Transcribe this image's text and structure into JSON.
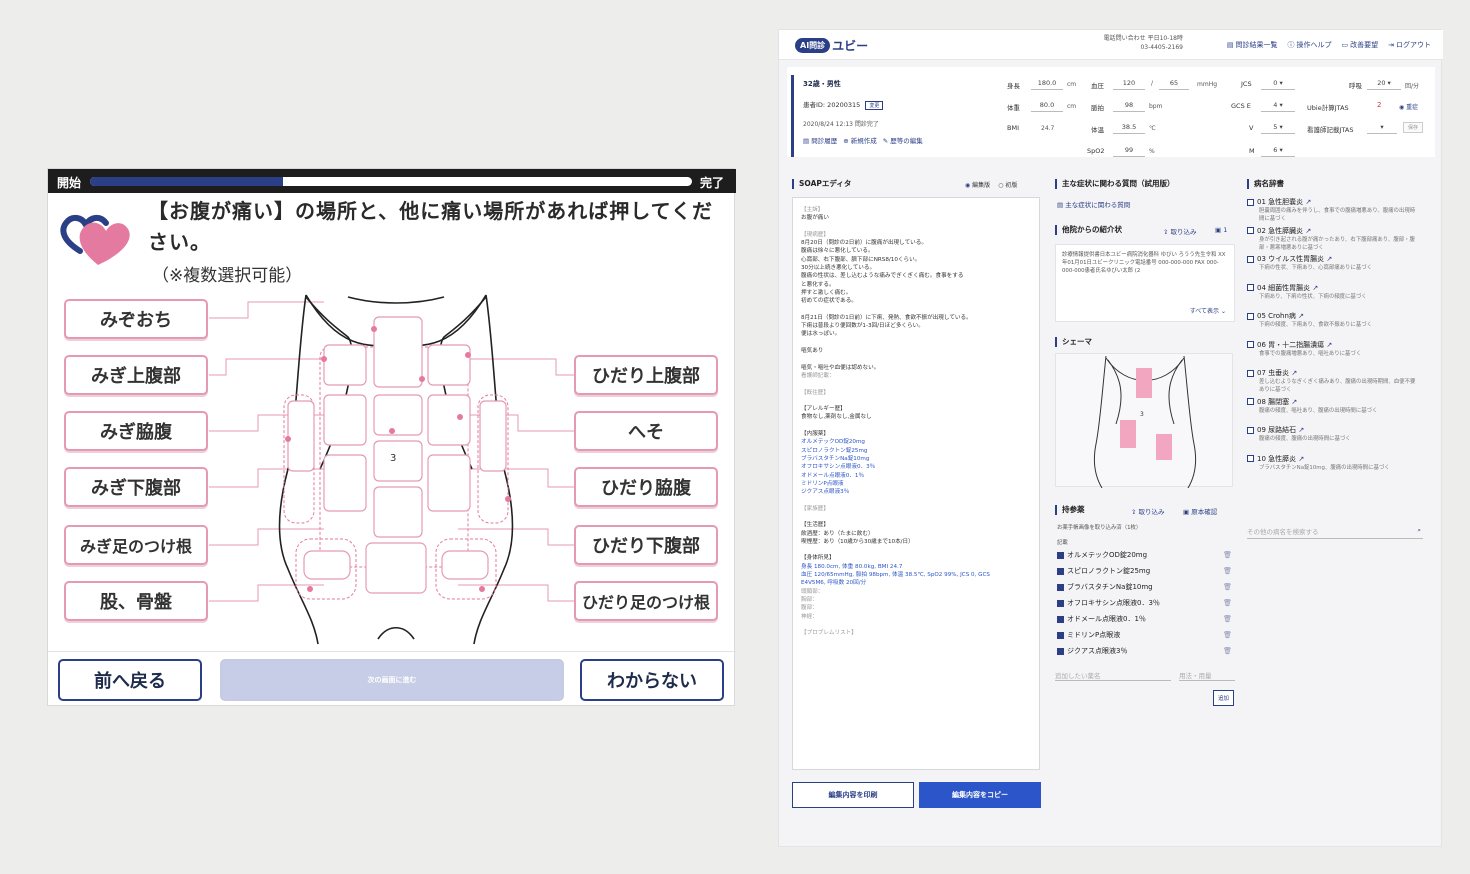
{
  "patient": {
    "progress_start": "開始",
    "progress_end": "完了",
    "progress_fraction": 0.32,
    "question": "【お腹が痛い】の場所と、他に痛い場所があれば押してください。",
    "note": "（※複数選択可能）",
    "left_regions": [
      "みぞおち",
      "みぎ上腹部",
      "みぎ脇腹",
      "みぎ下腹部",
      "みぎ足のつけ根",
      "股、骨盤"
    ],
    "right_regions": [
      "ひだり上腹部",
      "へそ",
      "ひだり脇腹",
      "ひだり下腹部",
      "ひだり足のつけ根"
    ],
    "nav": {
      "back": "前へ戻る",
      "next": "次の画面に進む",
      "unknown": "わからない"
    },
    "accent_color": "#e57aa0",
    "brand_color": "#2b3f86"
  },
  "doctor": {
    "logo_badge": "AI問診",
    "logo_text": "ユビー",
    "tel_label": "電話問い合わせ 平日10-18時",
    "tel": "03-4405-2169",
    "nav": [
      "問診結果一覧",
      "操作ヘルプ",
      "改善要望",
      "ログアウト"
    ],
    "patient": {
      "age_sex": "32歳・男性",
      "id": "患者ID: 20200315",
      "id_tag": "変更",
      "time": "2020/8/24 12:13 問診完了",
      "links": [
        "問診履歴",
        "新規作成",
        "歴等の編集"
      ]
    },
    "vitals": {
      "height_label": "身長",
      "height": "180.0",
      "height_unit": "cm",
      "weight_label": "体重",
      "weight": "80.0",
      "weight_unit": "cm",
      "bmi_label": "BMI",
      "bmi": "24.7",
      "bp_label": "血圧",
      "bp_sys": "120",
      "bp_dia": "65",
      "bp_unit": "mmHg",
      "pulse_label": "脈拍",
      "pulse": "98",
      "pulse_unit": "bpm",
      "temp_label": "体温",
      "temp": "38.5",
      "temp_unit": "℃",
      "spo2_label": "SpO2",
      "spo2": "99",
      "spo2_unit": "%",
      "jcs_label": "JCS",
      "jcs": "0",
      "gcs_label": "GCS E",
      "gcs_e": "4",
      "gcs_v_label": "V",
      "gcs_v": "5",
      "gcs_m_label": "M",
      "gcs_m": "6",
      "resp_label": "呼吸",
      "resp": "20",
      "resp_unit": "回/分",
      "jtas_label": "Ubie計算JTAS",
      "jtas": "2",
      "jtas_tag": "重症",
      "nurse_jtas_label": "看護師記載JTAS",
      "nurse_tag": "保存"
    },
    "soap": {
      "title": "SOAPエディタ",
      "mode_edit": "編集版",
      "mode_init": "初版",
      "lines": [
        [
          "g",
          "【主訴】"
        ],
        [
          "",
          "お腹が痛い"
        ],
        [
          "",
          ""
        ],
        [
          "g",
          "【現病歴】"
        ],
        [
          "",
          "8月20日（問診の2日前）に腹痛が出現している。"
        ],
        [
          "",
          "腹痛は徐々に悪化している。"
        ],
        [
          "",
          "心窩部、右下腹部、臍下部にNRS8/10くらい。"
        ],
        [
          "",
          "30分以上続き悪化している。"
        ],
        [
          "",
          "腹痛の性状は、差し込むような痛みでぎくぎく痛む。食事をする"
        ],
        [
          "",
          "と悪化する。"
        ],
        [
          "",
          "押すと激しく痛む。"
        ],
        [
          "",
          "初めての症状である。"
        ],
        [
          "",
          ""
        ],
        [
          "",
          "8月21日（問診の1日前）に下痢、発熱、食欲不振が出現している。"
        ],
        [
          "",
          "下痢は普段より便回数が1-3回/日ほど多くらい。"
        ],
        [
          "",
          "便は水っぽい。"
        ],
        [
          "",
          ""
        ],
        [
          "",
          "嘔気あり"
        ],
        [
          "",
          ""
        ],
        [
          "",
          "嘔気・嘔吐や血便は認めない。"
        ],
        [
          "g",
          "看護師記載："
        ],
        [
          "",
          ""
        ],
        [
          "g",
          "【既往歴】"
        ],
        [
          "",
          ""
        ],
        [
          "",
          "【アレルギー歴】"
        ],
        [
          "",
          "食物なし,薬剤なし,金属なし"
        ],
        [
          "",
          ""
        ],
        [
          "",
          "【内服薬】"
        ],
        [
          "b",
          "オルメテックOD錠20mg"
        ],
        [
          "b",
          "スピロノラクトン錠25mg"
        ],
        [
          "b",
          "ブラバスタチンNa錠10mg"
        ],
        [
          "b",
          "オフロキサシン点眼液0．3％"
        ],
        [
          "b",
          "オドメール点眼液0．1％"
        ],
        [
          "b",
          "ミドリンP点眼液"
        ],
        [
          "b",
          "ジクアス点眼液3％"
        ],
        [
          "",
          ""
        ],
        [
          "g",
          "【家族歴】"
        ],
        [
          "",
          ""
        ],
        [
          "",
          "【生活歴】"
        ],
        [
          "",
          "飲酒歴：あり（たまに飲む）"
        ],
        [
          "",
          "喫煙歴：あり（10歳から30歳まで10本/日）"
        ],
        [
          "",
          ""
        ],
        [
          "",
          "【身体所見】"
        ],
        [
          "b",
          "身長 180.0cm, 体重 80.0kg, BMI 24.7"
        ],
        [
          "b",
          "血圧 120/65mmHg, 脈拍 98bpm, 体温 38.5℃, SpO2 99%, JCS 0, GCS"
        ],
        [
          "b",
          "E4V5M6, 呼吸数 20回/分"
        ],
        [
          "g",
          "頭頸部："
        ],
        [
          "g",
          "胸部："
        ],
        [
          "g",
          "腹部："
        ],
        [
          "g",
          "神経："
        ],
        [
          "",
          ""
        ],
        [
          "g",
          "【プロブレムリスト】"
        ]
      ],
      "print_button": "編集内容を印刷",
      "copy_button": "編集内容をコピー"
    },
    "questions": {
      "title": "主な症状に関わる質問（試用版）",
      "link": "主な症状に関わる質問"
    },
    "referral": {
      "title": "他院からの紹介状",
      "import": "取り込み",
      "count": "1",
      "text": "診療情報提供書日本ユビー病院消化器科 ゆびい ろうう先生令和 XX年01月01日ユビークリニック電話番号 000-000-000 FAX 000-000-000患者氏名ゆびい太郎 (2",
      "more": "すべて表示"
    },
    "schema": {
      "title": "シェーマ",
      "label": "3"
    },
    "meds": {
      "title": "持参薬",
      "import": "取り込み",
      "photo": "原本確認",
      "sub": "お薬手帳画像を取り込み済（1枚）",
      "sub2": "記載",
      "items": [
        "オルメテックOD錠20mg",
        "スピロノラクトン錠25mg",
        "ブラバスタチンNa錠10mg",
        "オフロキサシン点眼液0．3％",
        "オドメール点眼液0．1％",
        "ミドリンP点眼液",
        "ジクアス点眼液3％"
      ],
      "add_name_ph": "追加したい薬名",
      "add_dose_ph": "用法・用量",
      "add_button": "追加"
    },
    "diseases": {
      "title": "病名辞書",
      "items": [
        {
          "name": "01 急性胆嚢炎",
          "desc": "胆嚢周囲の痛みを伴うし、食事での腹痛増悪あり、腹痛の出現時間に基づく"
        },
        {
          "name": "02 急性膵臓炎",
          "desc": "身が引き起される腹が痛かったあり、右下腹部痛あり、腹部・腹部・悪寒増悪ありに基づく"
        },
        {
          "name": "03 ウイルス性胃腸炎",
          "desc": "下痢の性状、下痢あり、心窩部痛ありに基づく"
        },
        {
          "name": "04 細菌性胃腸炎",
          "desc": "下痢あり、下痢の性状、下痢の頻度に基づく"
        },
        {
          "name": "05 Crohn病",
          "desc": "下痢の頻度、下痢あり、食欲不振ありに基づく"
        },
        {
          "name": "06 胃・十二指腸潰瘍",
          "desc": "食事での腹痛増悪あり、嘔吐ありに基づく"
        },
        {
          "name": "07 虫垂炎",
          "desc": "差し込むようなぎくぎく痛みあり、腹痛の出現時期間、血便不要ありに基づく"
        },
        {
          "name": "08 腸閉塞",
          "desc": "腹痛の頻度、嘔吐あり、腹痛の出現時間に基づく"
        },
        {
          "name": "09 尿路結石",
          "desc": "腹痛の頻度、腹痛の出現時間に基づく"
        },
        {
          "name": "10 急性膵炎",
          "desc": "ブラバスタチンNa錠10mg、腹痛の出現時間に基づく"
        }
      ],
      "search_ph": "その他の病名を検索する"
    }
  }
}
